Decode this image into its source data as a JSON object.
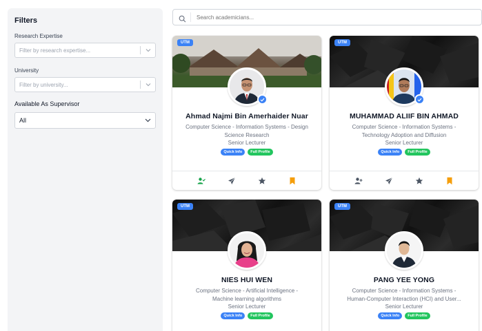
{
  "filters": {
    "title": "Filters",
    "research_label": "Research Expertise",
    "research_placeholder": "Filter by research expertise...",
    "university_label": "University",
    "university_placeholder": "Filter by university...",
    "supervisor_label": "Available As Supervisor",
    "supervisor_value": "All"
  },
  "search": {
    "placeholder": "Search academicians..."
  },
  "colors": {
    "accent": "#3b82f6",
    "success": "#22c55e",
    "bookmark": "#f59e0b",
    "add_user": "#16a34a"
  },
  "cards": [
    {
      "tag": "UTM",
      "name": "Ahmad Najmi Bin Amerhaider Nuar",
      "field_line1": "Computer Science - Information Systems - Design",
      "field_line2": "Science Research",
      "position": "Senior Lecturer",
      "quick": "Quick Info",
      "full": "Full Profile"
    },
    {
      "tag": "UTM",
      "name": "MUHAMMAD ALIIF BIN AHMAD",
      "field_line1": "Computer Science - Information Systems -",
      "field_line2": "Technology Adoption and Diffusion",
      "position": "Senior Lecturer",
      "quick": "Quick Info",
      "full": "Full Profile"
    },
    {
      "tag": "UTM",
      "name": "NIES HUI WEN",
      "field_line1": "Computer Science - Artificial Intelligence -",
      "field_line2": "Machine learning algorithms",
      "position": "Senior Lecturer",
      "quick": "Quick Info",
      "full": "Full Profile"
    },
    {
      "tag": "UTM",
      "name": "PANG YEE YONG",
      "field_line1": "Computer Science - Information Systems -",
      "field_line2": "Human-Computer Interaction (HCI) and User...",
      "position": "Senior Lecturer",
      "quick": "Quick Info",
      "full": "Full Profile"
    }
  ]
}
